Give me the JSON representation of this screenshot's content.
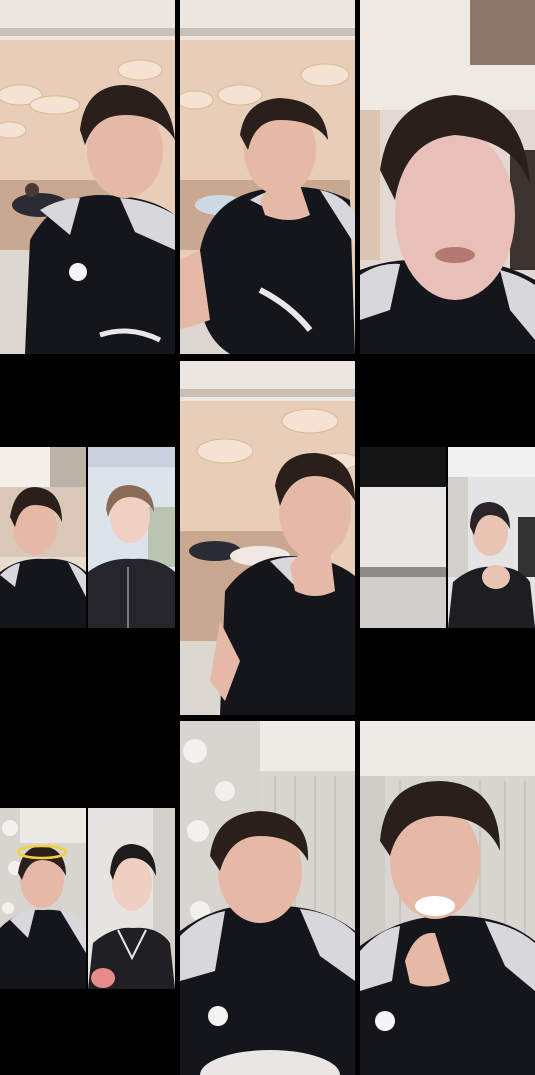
{
  "app": {
    "view": "live-replay-grid"
  },
  "colors": {
    "background": "#000000",
    "wall_warm": "#e9cdb9",
    "ceiling": "#f2ece6",
    "shirt_dark": "#15151c",
    "shirt_light": "#d8d8dc",
    "skin": "#e6b9a6",
    "hair": "#2a1f1b",
    "curtain": "#d9d6d1",
    "floral_wallpaper": "#d8d4cf"
  },
  "tiles": [
    {
      "id": "t1",
      "scene": "host-smiling-living-room"
    },
    {
      "id": "t2",
      "scene": "host-sitting-hand-on-mouth"
    },
    {
      "id": "t3",
      "scene": "host-closeup-ceiling"
    },
    {
      "id": "t4",
      "scene": "split-host-and-guest"
    },
    {
      "id": "t5",
      "scene": "host-hand-on-mouth-living-room"
    },
    {
      "id": "t6",
      "scene": "split-room-and-guest-laughing"
    },
    {
      "id": "t7",
      "scene": "split-host-halo-filter-and-guest"
    },
    {
      "id": "t8",
      "scene": "host-eyes-closed-curtains"
    },
    {
      "id": "t9",
      "scene": "host-laughing-curtains"
    }
  ]
}
